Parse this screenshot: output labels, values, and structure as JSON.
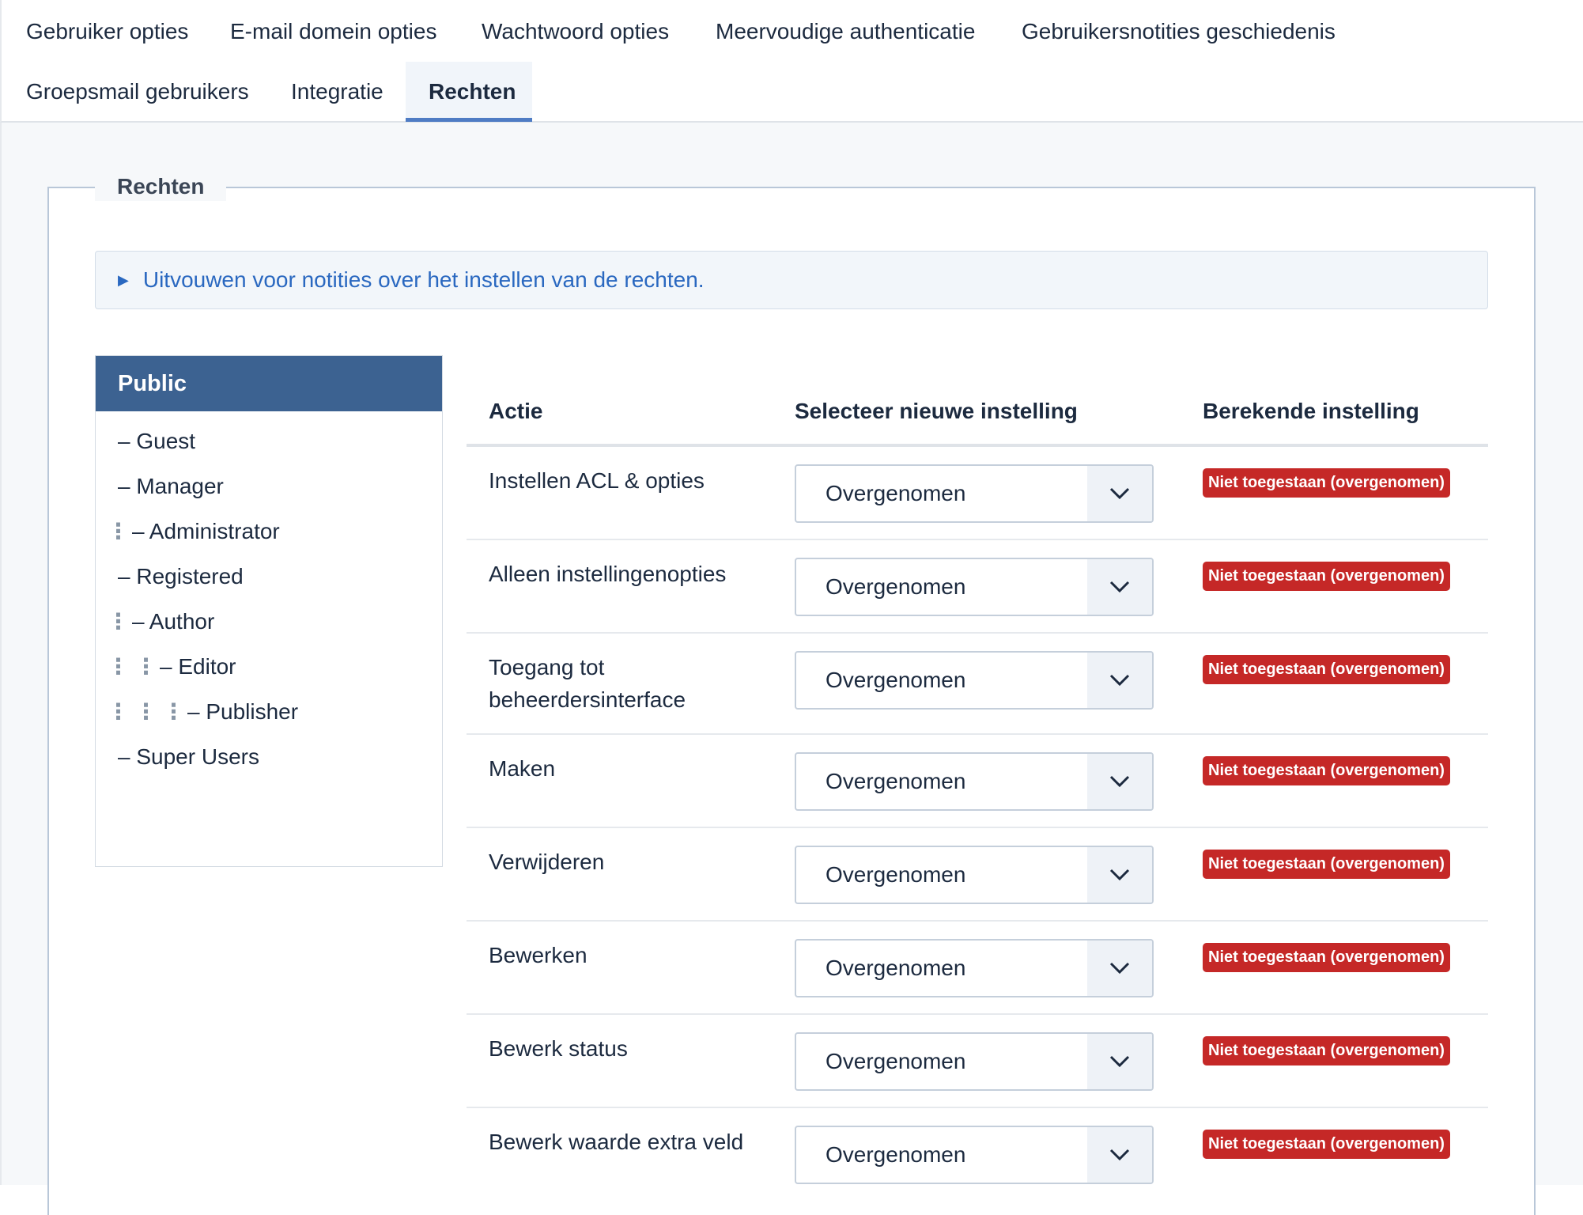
{
  "tabs": [
    {
      "label": "Gebruiker opties",
      "active": false
    },
    {
      "label": "E-mail domein opties",
      "active": false
    },
    {
      "label": "Wachtwoord opties",
      "active": false
    },
    {
      "label": "Meervoudige authenticatie",
      "active": false
    },
    {
      "label": "Gebruikersnotities geschiedenis",
      "active": false
    },
    {
      "label": "Groepsmail gebruikers",
      "active": false
    },
    {
      "label": "Integratie",
      "active": false
    },
    {
      "label": "Rechten",
      "active": true
    }
  ],
  "fieldset": {
    "legend": "Rechten"
  },
  "notes": {
    "icon": "triangle-right-icon",
    "label": "Uitvouwen voor notities over het instellen van de rechten."
  },
  "groups": {
    "selected": "Public",
    "items": [
      {
        "label": "– Guest",
        "depth": 0
      },
      {
        "label": "– Manager",
        "depth": 0
      },
      {
        "label": "– Administrator",
        "depth": 1
      },
      {
        "label": "– Registered",
        "depth": 0
      },
      {
        "label": "– Author",
        "depth": 1
      },
      {
        "label": "– Editor",
        "depth": 2
      },
      {
        "label": "– Publisher",
        "depth": 3
      },
      {
        "label": "– Super Users",
        "depth": 0
      }
    ]
  },
  "table": {
    "headers": {
      "action": "Actie",
      "select": "Selecteer nieuwe instelling",
      "calculated": "Berekende instelling"
    },
    "rows": [
      {
        "action": "Instellen ACL & opties",
        "setting": "Overgenomen",
        "calculated": "Niet toegestaan (overgenomen)"
      },
      {
        "action": "Alleen instellingenopties",
        "setting": "Overgenomen",
        "calculated": "Niet toegestaan (overgenomen)"
      },
      {
        "action": "Toegang tot beheerdersinterface",
        "setting": "Overgenomen",
        "calculated": "Niet toegestaan (overgenomen)"
      },
      {
        "action": "Maken",
        "setting": "Overgenomen",
        "calculated": "Niet toegestaan (overgenomen)"
      },
      {
        "action": "Verwijderen",
        "setting": "Overgenomen",
        "calculated": "Niet toegestaan (overgenomen)"
      },
      {
        "action": "Bewerken",
        "setting": "Overgenomen",
        "calculated": "Niet toegestaan (overgenomen)"
      },
      {
        "action": "Bewerk status",
        "setting": "Overgenomen",
        "calculated": "Niet toegestaan (overgenomen)"
      },
      {
        "action": "Bewerk waarde extra veld",
        "setting": "Overgenomen",
        "calculated": "Niet toegestaan (overgenomen)"
      }
    ]
  },
  "colors": {
    "accent": "#3c6291",
    "badge": "#c52827",
    "link": "#2a68c0"
  }
}
